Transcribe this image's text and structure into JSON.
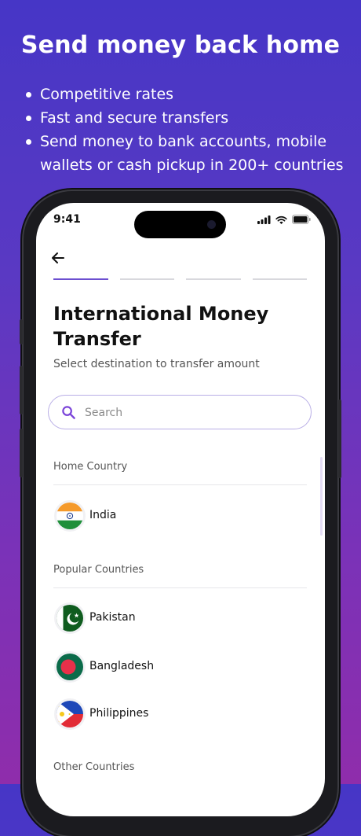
{
  "promo": {
    "title": "Send money back home",
    "bullets": [
      "Competitive rates",
      "Fast and secure transfers",
      "Send money to bank accounts, mobile wallets or cash pickup in 200+ countries"
    ]
  },
  "status_bar": {
    "time": "9:41"
  },
  "screen": {
    "title": "International Money Transfer",
    "subtitle": "Select destination to transfer amount",
    "progress": {
      "total_steps": 4,
      "current_step": 1
    },
    "search": {
      "placeholder": "Search",
      "value": ""
    },
    "sections": {
      "home": "Home Country",
      "popular": "Popular Countries",
      "other": "Other Countries"
    },
    "home_country": {
      "name": "India",
      "flag": "india-flag"
    },
    "popular_countries": [
      {
        "name": "Pakistan",
        "flag": "pakistan-flag"
      },
      {
        "name": "Bangladesh",
        "flag": "bangladesh-flag"
      },
      {
        "name": "Philippines",
        "flag": "philippines-flag"
      }
    ]
  },
  "colors": {
    "background_top": "#4636c6",
    "background_bottom": "#8f2dab",
    "accent": "#6c4fd0",
    "search_border": "#b9aee6"
  }
}
